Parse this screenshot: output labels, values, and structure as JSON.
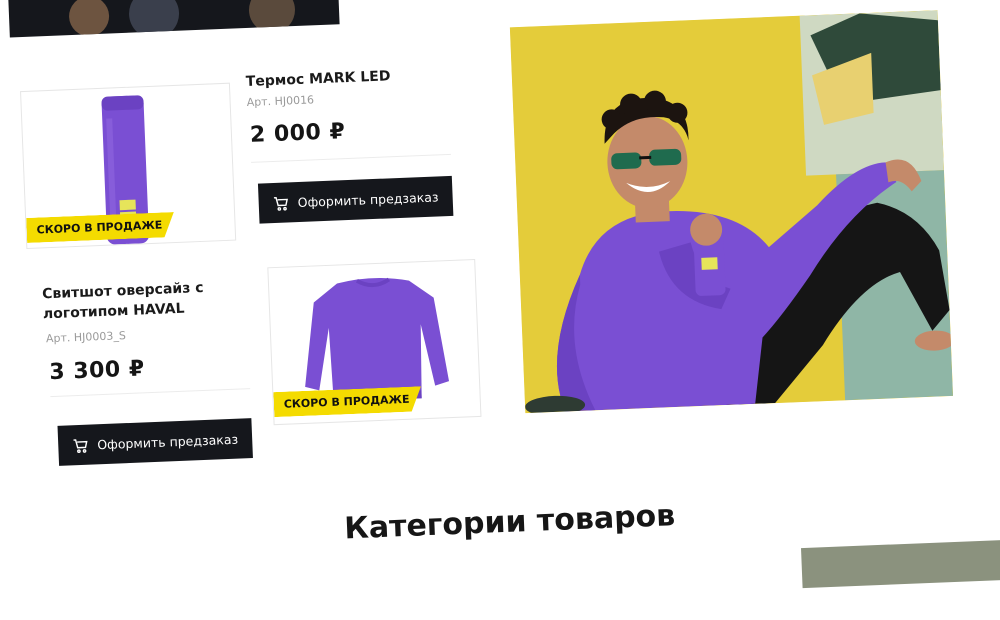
{
  "products": [
    {
      "title": "Термос MARK LED",
      "article": "Арт. HJ0016",
      "price": "2 000 ₽",
      "badge": "СКОРО В ПРОДАЖЕ",
      "button_label": "Оформить предзаказ"
    },
    {
      "title_line1": "Свитшот оверсайз с",
      "title_line2": "логотипом HAVAL",
      "article": "Арт. HJ0003_S",
      "price": "3 300 ₽",
      "badge": "СКОРО В ПРОДАЖЕ",
      "button_label": "Оформить предзаказ"
    }
  ],
  "categories": {
    "title": "Категории товаров"
  },
  "colors": {
    "accent_yellow": "#f4db00",
    "dark": "#15171c",
    "product_purple": "#7a4fd3"
  },
  "icons": [
    "cart-icon"
  ]
}
